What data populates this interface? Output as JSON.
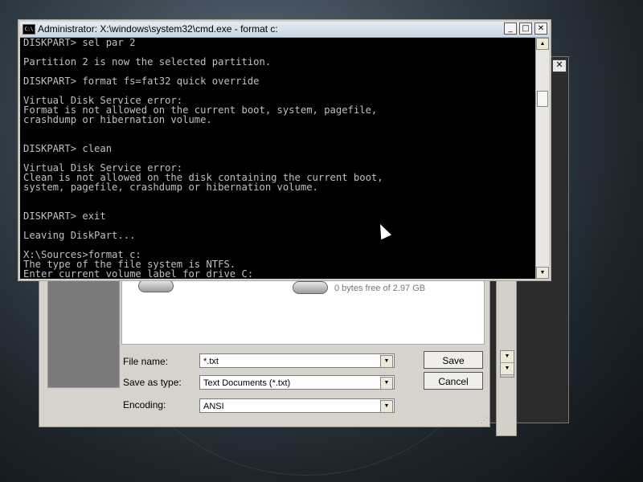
{
  "cmd": {
    "title": "Administrator: X:\\windows\\system32\\cmd.exe - format  c:",
    "icon_text": "C:\\",
    "lines": [
      "DISKPART> sel par 2",
      "",
      "Partition 2 is now the selected partition.",
      "",
      "DISKPART> format fs=fat32 quick override",
      "",
      "Virtual Disk Service error:",
      "Format is not allowed on the current boot, system, pagefile,",
      "crashdump or hibernation volume.",
      "",
      "",
      "DISKPART> clean",
      "",
      "Virtual Disk Service error:",
      "Clean is not allowed on the disk containing the current boot,",
      "system, pagefile, crashdump or hibernation volume.",
      "",
      "",
      "DISKPART> exit",
      "",
      "Leaving DiskPart...",
      "",
      "X:\\Sources>format c:",
      "The type of the file system is NTFS.",
      "Enter current volume label for drive C:"
    ],
    "buttons": {
      "minimize": "_",
      "maximize": "□",
      "close": "✕"
    }
  },
  "save_dialog": {
    "drive_free": "0 bytes free of 2.97 GB",
    "file_name_label": "File name:",
    "file_name_value": "*.txt",
    "save_type_label": "Save as type:",
    "save_type_value": "Text Documents (*.txt)",
    "encoding_label": "Encoding:",
    "encoding_value": "ANSI",
    "save_button": "Save",
    "cancel_button": "Cancel"
  },
  "back_window": {
    "close": "✕"
  },
  "icons": {
    "dropdown": "▼",
    "scroll_up": "▲",
    "scroll_down": "▼",
    "grip": "⋰"
  }
}
